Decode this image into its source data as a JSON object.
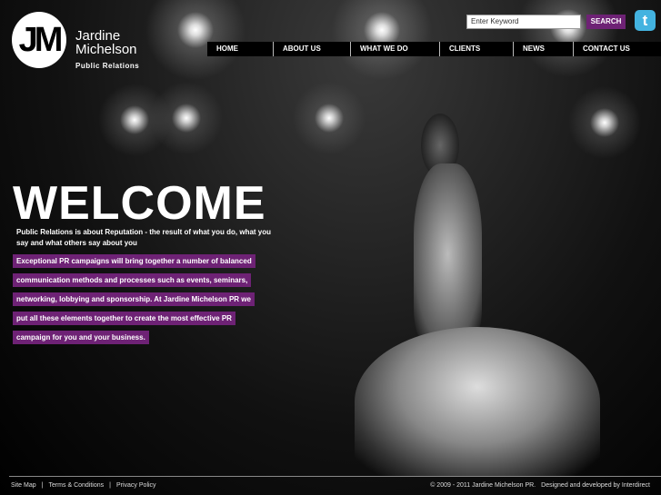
{
  "brand": {
    "logo_text": "JM",
    "name1": "Jardine",
    "name2": "Michelson",
    "tagline": "Public Relations"
  },
  "search": {
    "placeholder": "Enter Keyword",
    "button": "SEARCH"
  },
  "nav": [
    "HOME",
    "ABOUT US",
    "WHAT WE DO",
    "CLIENTS",
    "NEWS",
    "CONTACT US"
  ],
  "main": {
    "title": "WELCOME",
    "intro": "Public Relations is about Reputation - the result of what you do, what you say and what others say about you",
    "highlights": [
      "Exceptional PR campaigns will bring together a number of balanced",
      "communication methods and processes such as events, seminars,",
      "networking, lobbying and sponsorship. At Jardine Michelson PR we",
      "put all these elements together to create the most effective PR",
      "campaign for you and your business."
    ]
  },
  "footer": {
    "links": [
      "Site Map",
      "Terms & Conditions",
      "Privacy Policy"
    ],
    "sep": "|",
    "copyright": "© 2009 - 2011 Jardine Michelson PR.",
    "credit": "Designed and developed by Interdirect"
  }
}
